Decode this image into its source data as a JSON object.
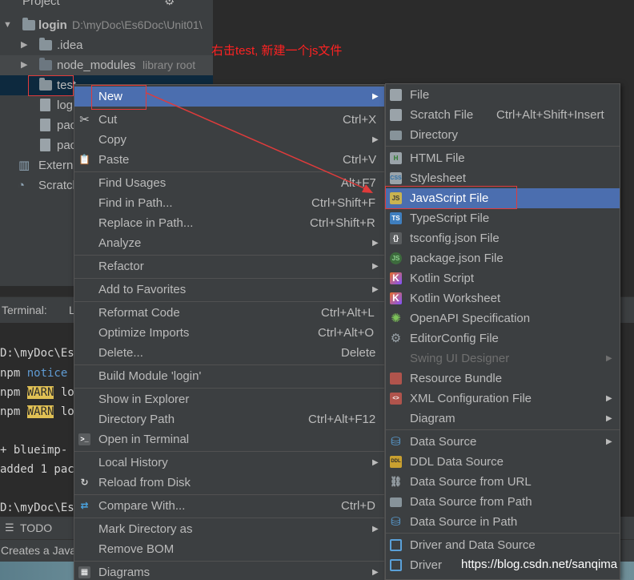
{
  "project_panel": {
    "title": "Project",
    "rows": [
      {
        "label": "login",
        "path": "D:\\myDoc\\Es6Doc\\Unit01\\"
      },
      {
        "label": ".idea"
      },
      {
        "label": "node_modules",
        "note": "library root"
      },
      {
        "label": "test"
      },
      {
        "label": "log"
      },
      {
        "label": "pac"
      },
      {
        "label": "pac"
      },
      {
        "label": "Externa"
      },
      {
        "label": "Scratch"
      }
    ]
  },
  "terminal": {
    "tab_label": "Terminal:",
    "tab_local": "L",
    "lines": [
      "D:\\myDoc\\Es",
      "npm ",
      "notice",
      "npm ",
      "WARN",
      " lo",
      "npm ",
      "WARN",
      " lo",
      "+ blueimp-",
      "added 1 pac",
      "D:\\myDoc\\Es"
    ]
  },
  "bottom_bar": {
    "todo_label": "TODO"
  },
  "status_bar": {
    "text": "Creates a Java"
  },
  "annotation": {
    "text": "右击test, 新建一个js文件"
  },
  "watermark": {
    "text": "https://blog.csdn.net/sanqima"
  },
  "context_menu": {
    "items": [
      {
        "label": "New",
        "submenu": true
      },
      {
        "label": "Cut",
        "shortcut": "Ctrl+X"
      },
      {
        "label": "Copy",
        "submenu": true
      },
      {
        "label": "Paste",
        "shortcut": "Ctrl+V"
      },
      {
        "label": "Find Usages",
        "shortcut": "Alt+F7"
      },
      {
        "label": "Find in Path...",
        "shortcut": "Ctrl+Shift+F"
      },
      {
        "label": "Replace in Path...",
        "shortcut": "Ctrl+Shift+R"
      },
      {
        "label": "Analyze",
        "submenu": true
      },
      {
        "label": "Refactor",
        "submenu": true
      },
      {
        "label": "Add to Favorites",
        "submenu": true
      },
      {
        "label": "Reformat Code",
        "shortcut": "Ctrl+Alt+L"
      },
      {
        "label": "Optimize Imports",
        "shortcut": "Ctrl+Alt+O"
      },
      {
        "label": "Delete...",
        "shortcut": "Delete"
      },
      {
        "label": "Build Module 'login'"
      },
      {
        "label": "Show in Explorer"
      },
      {
        "label": "Directory Path",
        "shortcut": "Ctrl+Alt+F12"
      },
      {
        "label": "Open in Terminal"
      },
      {
        "label": "Local History",
        "submenu": true
      },
      {
        "label": "Reload from Disk"
      },
      {
        "label": "Compare With...",
        "shortcut": "Ctrl+D"
      },
      {
        "label": "Mark Directory as",
        "submenu": true
      },
      {
        "label": "Remove BOM"
      },
      {
        "label": "Diagrams",
        "submenu": true
      }
    ]
  },
  "new_submenu": {
    "items": [
      {
        "label": "File"
      },
      {
        "label": "Scratch File",
        "shortcut": "Ctrl+Alt+Shift+Insert"
      },
      {
        "label": "Directory"
      },
      {
        "label": "HTML File"
      },
      {
        "label": "Stylesheet"
      },
      {
        "label": "JavaScript File"
      },
      {
        "label": "TypeScript File"
      },
      {
        "label": "tsconfig.json File"
      },
      {
        "label": "package.json File"
      },
      {
        "label": "Kotlin Script"
      },
      {
        "label": "Kotlin Worksheet"
      },
      {
        "label": "OpenAPI Specification"
      },
      {
        "label": "EditorConfig File"
      },
      {
        "label": "Swing UI Designer",
        "submenu": true,
        "disabled": true
      },
      {
        "label": "Resource Bundle"
      },
      {
        "label": "XML Configuration File",
        "submenu": true
      },
      {
        "label": "Diagram",
        "submenu": true
      },
      {
        "label": "Data Source",
        "submenu": true
      },
      {
        "label": "DDL Data Source"
      },
      {
        "label": "Data Source from URL"
      },
      {
        "label": "Data Source from Path"
      },
      {
        "label": "Data Source in Path"
      },
      {
        "label": "Driver and Data Source"
      },
      {
        "label": "Driver"
      }
    ]
  },
  "colors": {
    "menu_bg": "#3c3f41",
    "highlight": "#4b6eaf",
    "annotation_red": "#e03b3b"
  }
}
